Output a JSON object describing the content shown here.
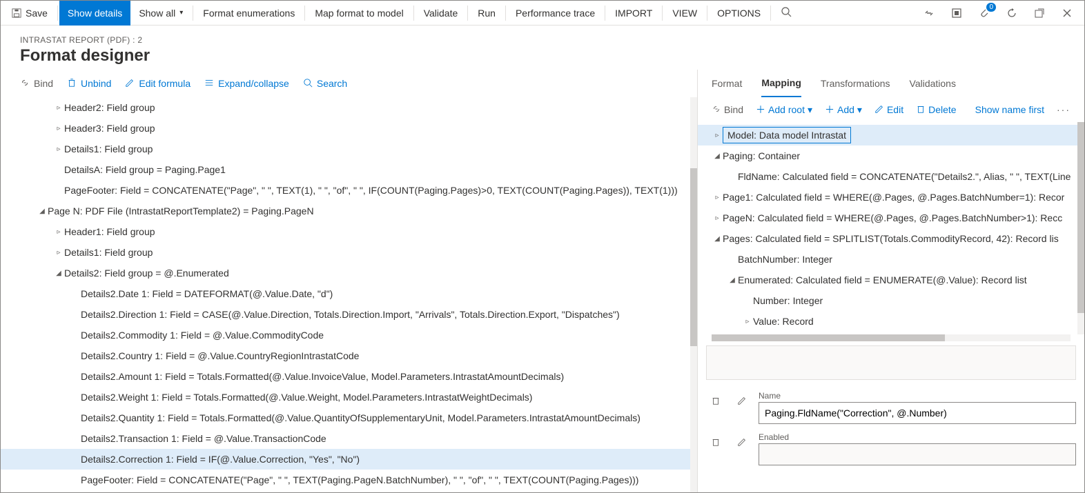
{
  "toolbar": {
    "save": "Save",
    "show_details": "Show details",
    "show_all": "Show all",
    "format_enum": "Format enumerations",
    "map_format": "Map format to model",
    "validate": "Validate",
    "run": "Run",
    "perf_trace": "Performance trace",
    "import": "IMPORT",
    "view": "VIEW",
    "options": "OPTIONS"
  },
  "titlebar": {
    "badge": "0"
  },
  "breadcrumb": "INTRASTAT REPORT (PDF) : 2",
  "page_title": "Format designer",
  "left_toolbar": {
    "bind": "Bind",
    "unbind": "Unbind",
    "edit_formula": "Edit formula",
    "expand": "Expand/collapse",
    "search": "Search"
  },
  "left_tree": [
    {
      "indent": 2,
      "toggle": "▹",
      "text": "Header2: Field group"
    },
    {
      "indent": 2,
      "toggle": "▹",
      "text": "Header3: Field group"
    },
    {
      "indent": 2,
      "toggle": "▹",
      "text": "Details1: Field group"
    },
    {
      "indent": 2,
      "toggle": "",
      "text": "DetailsA: Field group = Paging.Page1"
    },
    {
      "indent": 2,
      "toggle": "",
      "text": "PageFooter: Field = CONCATENATE(\"Page\", \" \", TEXT(1), \" \", \"of\", \" \", IF(COUNT(Paging.Pages)>0, TEXT(COUNT(Paging.Pages)), TEXT(1)))"
    },
    {
      "indent": 1,
      "toggle": "◢",
      "text": "Page N: PDF File (IntrastatReportTemplate2) = Paging.PageN"
    },
    {
      "indent": 2,
      "toggle": "▹",
      "text": "Header1: Field group"
    },
    {
      "indent": 2,
      "toggle": "▹",
      "text": "Details1: Field group"
    },
    {
      "indent": 2,
      "toggle": "◢",
      "text": "Details2: Field group = @.Enumerated"
    },
    {
      "indent": 3,
      "toggle": "",
      "text": "Details2.Date 1: Field = DATEFORMAT(@.Value.Date, \"d\")"
    },
    {
      "indent": 3,
      "toggle": "",
      "text": "Details2.Direction 1: Field = CASE(@.Value.Direction, Totals.Direction.Import, \"Arrivals\", Totals.Direction.Export, \"Dispatches\")"
    },
    {
      "indent": 3,
      "toggle": "",
      "text": "Details2.Commodity 1: Field = @.Value.CommodityCode"
    },
    {
      "indent": 3,
      "toggle": "",
      "text": "Details2.Country 1: Field = @.Value.CountryRegionIntrastatCode"
    },
    {
      "indent": 3,
      "toggle": "",
      "text": "Details2.Amount 1: Field = Totals.Formatted(@.Value.InvoiceValue, Model.Parameters.IntrastatAmountDecimals)"
    },
    {
      "indent": 3,
      "toggle": "",
      "text": "Details2.Weight 1: Field = Totals.Formatted(@.Value.Weight, Model.Parameters.IntrastatWeightDecimals)"
    },
    {
      "indent": 3,
      "toggle": "",
      "text": "Details2.Quantity 1: Field = Totals.Formatted(@.Value.QuantityOfSupplementaryUnit, Model.Parameters.IntrastatAmountDecimals)"
    },
    {
      "indent": 3,
      "toggle": "",
      "text": "Details2.Transaction 1: Field = @.Value.TransactionCode"
    },
    {
      "indent": 3,
      "toggle": "",
      "text": "Details2.Correction 1: Field = IF(@.Value.Correction, \"Yes\", \"No\")",
      "selected": true
    },
    {
      "indent": 3,
      "toggle": "",
      "text": "PageFooter: Field = CONCATENATE(\"Page\", \" \", TEXT(Paging.PageN.BatchNumber), \" \", \"of\", \" \", TEXT(COUNT(Paging.Pages)))"
    }
  ],
  "right_tabs": {
    "format": "Format",
    "mapping": "Mapping",
    "transformations": "Transformations",
    "validations": "Validations"
  },
  "right_toolbar": {
    "bind": "Bind",
    "add_root": "Add root",
    "add": "Add",
    "edit": "Edit",
    "delete": "Delete",
    "show_name": "Show name first"
  },
  "right_tree": [
    {
      "indent": 0,
      "toggle": "▹",
      "text": "Model: Data model Intrastat",
      "selected": true
    },
    {
      "indent": 0,
      "toggle": "◢",
      "text": "Paging: Container"
    },
    {
      "indent": 1,
      "toggle": "",
      "text": "FldName: Calculated field = CONCATENATE(\"Details2.\", Alias, \" \", TEXT(Line"
    },
    {
      "indent": 0,
      "toggle": "▹",
      "text": "Page1: Calculated field = WHERE(@.Pages, @.Pages.BatchNumber=1): Recor"
    },
    {
      "indent": 0,
      "toggle": "▹",
      "text": "PageN: Calculated field = WHERE(@.Pages, @.Pages.BatchNumber>1): Recc"
    },
    {
      "indent": 0,
      "toggle": "◢",
      "text": "Pages: Calculated field = SPLITLIST(Totals.CommodityRecord, 42): Record lis"
    },
    {
      "indent": 1,
      "toggle": "",
      "text": "BatchNumber: Integer"
    },
    {
      "indent": 1,
      "toggle": "◢",
      "text": "Enumerated: Calculated field = ENUMERATE(@.Value): Record list"
    },
    {
      "indent": 2,
      "toggle": "",
      "text": "Number: Integer"
    },
    {
      "indent": 2,
      "toggle": "▹",
      "text": "Value: Record"
    }
  ],
  "detail": {
    "name_label": "Name",
    "name_value": "Paging.FldName(\"Correction\", @.Number)",
    "enabled_label": "Enabled",
    "enabled_value": ""
  }
}
